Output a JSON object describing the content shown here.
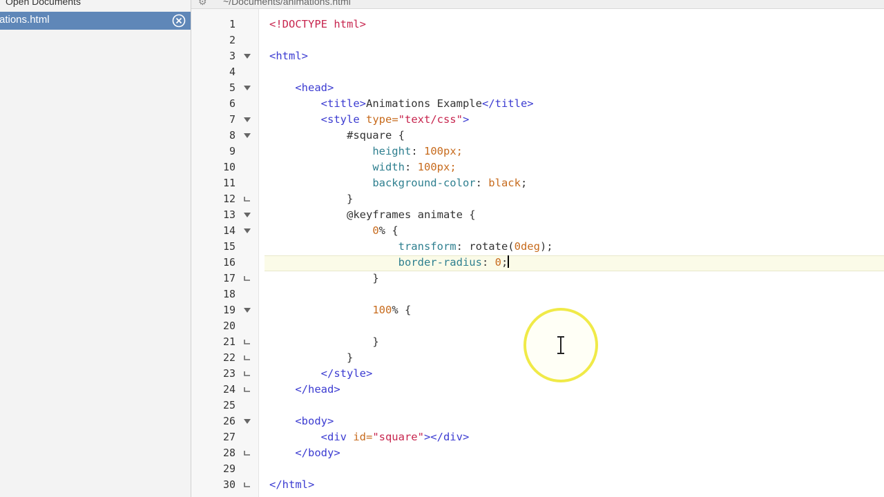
{
  "sidebar": {
    "heading": "Open Documents",
    "open_document": "ations.html"
  },
  "path_bar": {
    "gear_icon": "gear-icon",
    "path": "~/Documents/animations.html"
  },
  "editor": {
    "current_line": 16,
    "lines": [
      {
        "n": "1",
        "fold": ""
      },
      {
        "n": "2",
        "fold": ""
      },
      {
        "n": "3",
        "fold": "down"
      },
      {
        "n": "4",
        "fold": ""
      },
      {
        "n": "5",
        "fold": "down"
      },
      {
        "n": "6",
        "fold": ""
      },
      {
        "n": "7",
        "fold": "down"
      },
      {
        "n": "8",
        "fold": "down"
      },
      {
        "n": "9",
        "fold": ""
      },
      {
        "n": "10",
        "fold": ""
      },
      {
        "n": "11",
        "fold": ""
      },
      {
        "n": "12",
        "fold": "end"
      },
      {
        "n": "13",
        "fold": "down"
      },
      {
        "n": "14",
        "fold": "down"
      },
      {
        "n": "15",
        "fold": ""
      },
      {
        "n": "16",
        "fold": ""
      },
      {
        "n": "17",
        "fold": "end"
      },
      {
        "n": "18",
        "fold": ""
      },
      {
        "n": "19",
        "fold": "down"
      },
      {
        "n": "20",
        "fold": ""
      },
      {
        "n": "21",
        "fold": "end"
      },
      {
        "n": "22",
        "fold": "end"
      },
      {
        "n": "23",
        "fold": "end"
      },
      {
        "n": "24",
        "fold": "end"
      },
      {
        "n": "25",
        "fold": ""
      },
      {
        "n": "26",
        "fold": "down"
      },
      {
        "n": "27",
        "fold": ""
      },
      {
        "n": "28",
        "fold": "end"
      },
      {
        "n": "29",
        "fold": ""
      },
      {
        "n": "30",
        "fold": "end"
      }
    ],
    "code": {
      "l1": "<!DOCTYPE html>",
      "l3": "<html>",
      "l5": "<head>",
      "l6_open": "<title>",
      "l6_text": "Animations Example",
      "l6_close": "</title>",
      "l7_open": "<style",
      "l7_attr": " type=",
      "l7_val": "\"text/css\"",
      "l7_end": ">",
      "l8": "#square {",
      "l9_prop": "height",
      "l9_colon": ": ",
      "l9_val": "100",
      "l9_unit": "px;",
      "l10_prop": "width",
      "l10_colon": ": ",
      "l10_val": "100",
      "l10_unit": "px;",
      "l11_prop": "background-color",
      "l11_colon": ": ",
      "l11_val": "black",
      "l11_end": ";",
      "l12": "}",
      "l13": "@keyframes animate {",
      "l14_val": "0",
      "l14_rest": "% {",
      "l15_prop": "transform",
      "l15_colon": ": rotate(",
      "l15_val": "0deg",
      "l15_end": ");",
      "l16_prop": "border-radius",
      "l16_colon": ": ",
      "l16_val": "0",
      "l16_end": ";",
      "l17": "}",
      "l19_val": "100",
      "l19_rest": "% {",
      "l21": "}",
      "l22": "}",
      "l23": "</style>",
      "l24": "</head>",
      "l26": "<body>",
      "l27_open": "<div",
      "l27_attr": " id=",
      "l27_val": "\"square\"",
      "l27_close": "></div>",
      "l28": "</body>",
      "l30": "</html>"
    }
  },
  "colors": {
    "selection": "#5f87b8",
    "cursor_ring": "#f0ea48",
    "tag": "#3b3bd1",
    "string": "#c7254e",
    "property": "#2e7f8f",
    "number": "#c76b1d"
  }
}
